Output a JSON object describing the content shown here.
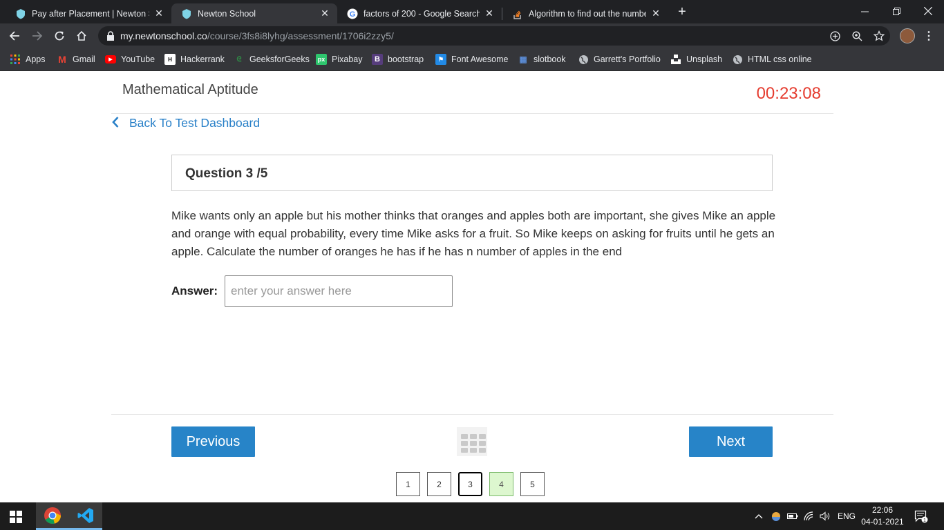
{
  "browser": {
    "tabs": [
      {
        "title": "Pay after Placement | Newton Sch",
        "active": false
      },
      {
        "title": "Newton School",
        "active": true
      },
      {
        "title": "factors of 200 - Google Search",
        "active": false
      },
      {
        "title": "Algorithm to find out the numbe",
        "active": false
      }
    ],
    "new_tab": "+",
    "url_host": "my.newtonschool.co",
    "url_path": "/course/3fs8i8lyhg/assessment/1706i2zzy5/",
    "bookmarks": [
      "Apps",
      "Gmail",
      "YouTube",
      "Hackerrank",
      "GeeksforGeeks",
      "Pixabay",
      "bootstrap",
      "Font Awesome",
      "slotbook",
      "Garrett's Portfolio",
      "Unsplash",
      "HTML css online"
    ]
  },
  "page": {
    "course_title": "Mathematical Aptitude",
    "timer": "00:23:08",
    "back_link": "Back To Test Dashboard",
    "question_header": "Question 3 /5",
    "question_text": "Mike wants only an apple but his mother thinks that oranges and apples both are important, she gives Mike an apple and orange with equal probability, every time Mike asks for a fruit. So Mike keeps on asking for fruits until he gets an apple. Calculate the number of oranges he has if he has n number of apples in the end",
    "answer_label": "Answer:",
    "answer_placeholder": "enter your answer here",
    "answer_value": "",
    "previous_label": "Previous",
    "next_label": "Next",
    "pages": [
      {
        "label": "1",
        "state": "default"
      },
      {
        "label": "2",
        "state": "default"
      },
      {
        "label": "3",
        "state": "current"
      },
      {
        "label": "4",
        "state": "answered"
      },
      {
        "label": "5",
        "state": "default"
      }
    ]
  },
  "taskbar": {
    "apps": [
      "chrome-icon",
      "vscode-icon"
    ],
    "language": "ENG",
    "time": "22:06",
    "date": "04-01-2021",
    "notification_count": "1"
  },
  "colors": {
    "accent": "#2784c8",
    "timer": "#e53c2f",
    "answered": "#ddf7cf"
  }
}
